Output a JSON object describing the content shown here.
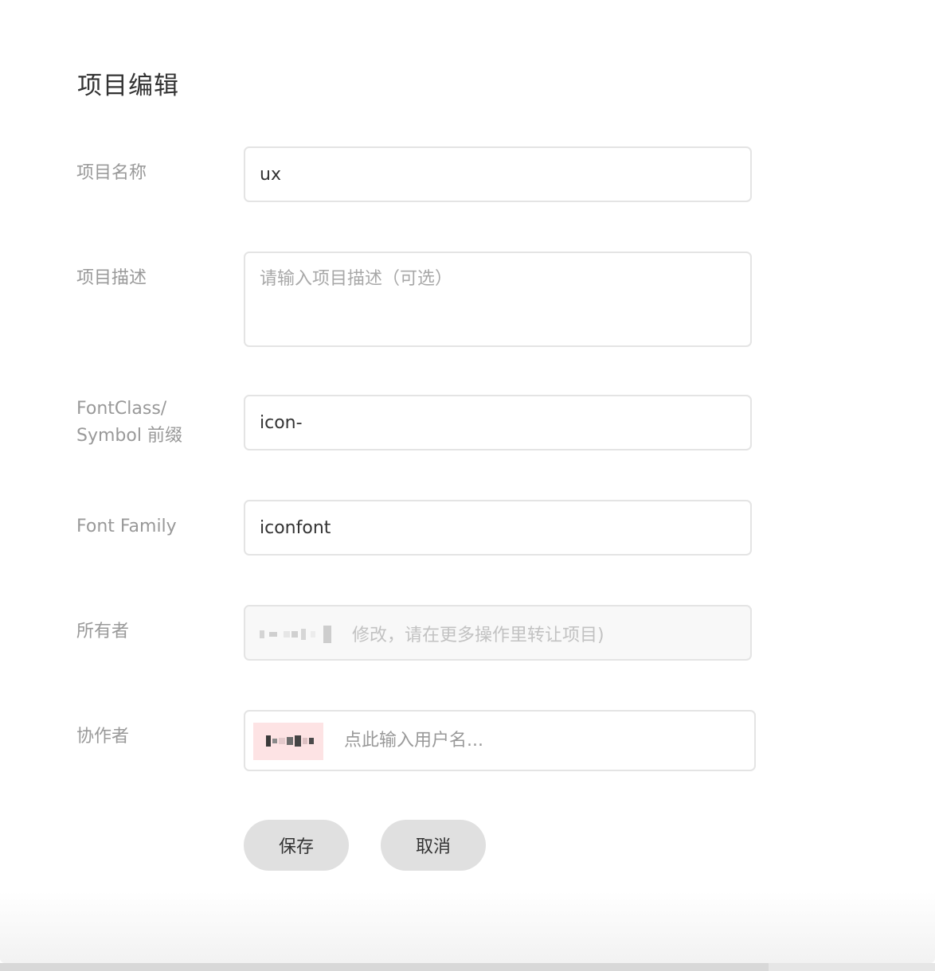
{
  "dialog": {
    "title": "项目编辑"
  },
  "form": {
    "name": {
      "label": "项目名称",
      "value": "ux"
    },
    "description": {
      "label": "项目描述",
      "value": "",
      "placeholder": "请输入项目描述（可选）"
    },
    "prefix": {
      "label_line1": "FontClass/",
      "label_line2": "Symbol 前缀",
      "value": "icon-"
    },
    "font_family": {
      "label": "Font Family",
      "value": "iconfont"
    },
    "owner": {
      "label": "所有者",
      "visible_text": "修改，请在更多操作里转让项目)",
      "name_redacted": true
    },
    "collaborators": {
      "label": "协作者",
      "placeholder": "点此输入用户名...",
      "chips": [
        {
          "name_redacted": true,
          "color": "#fde3e4"
        }
      ]
    }
  },
  "actions": {
    "save_label": "保存",
    "cancel_label": "取消"
  }
}
